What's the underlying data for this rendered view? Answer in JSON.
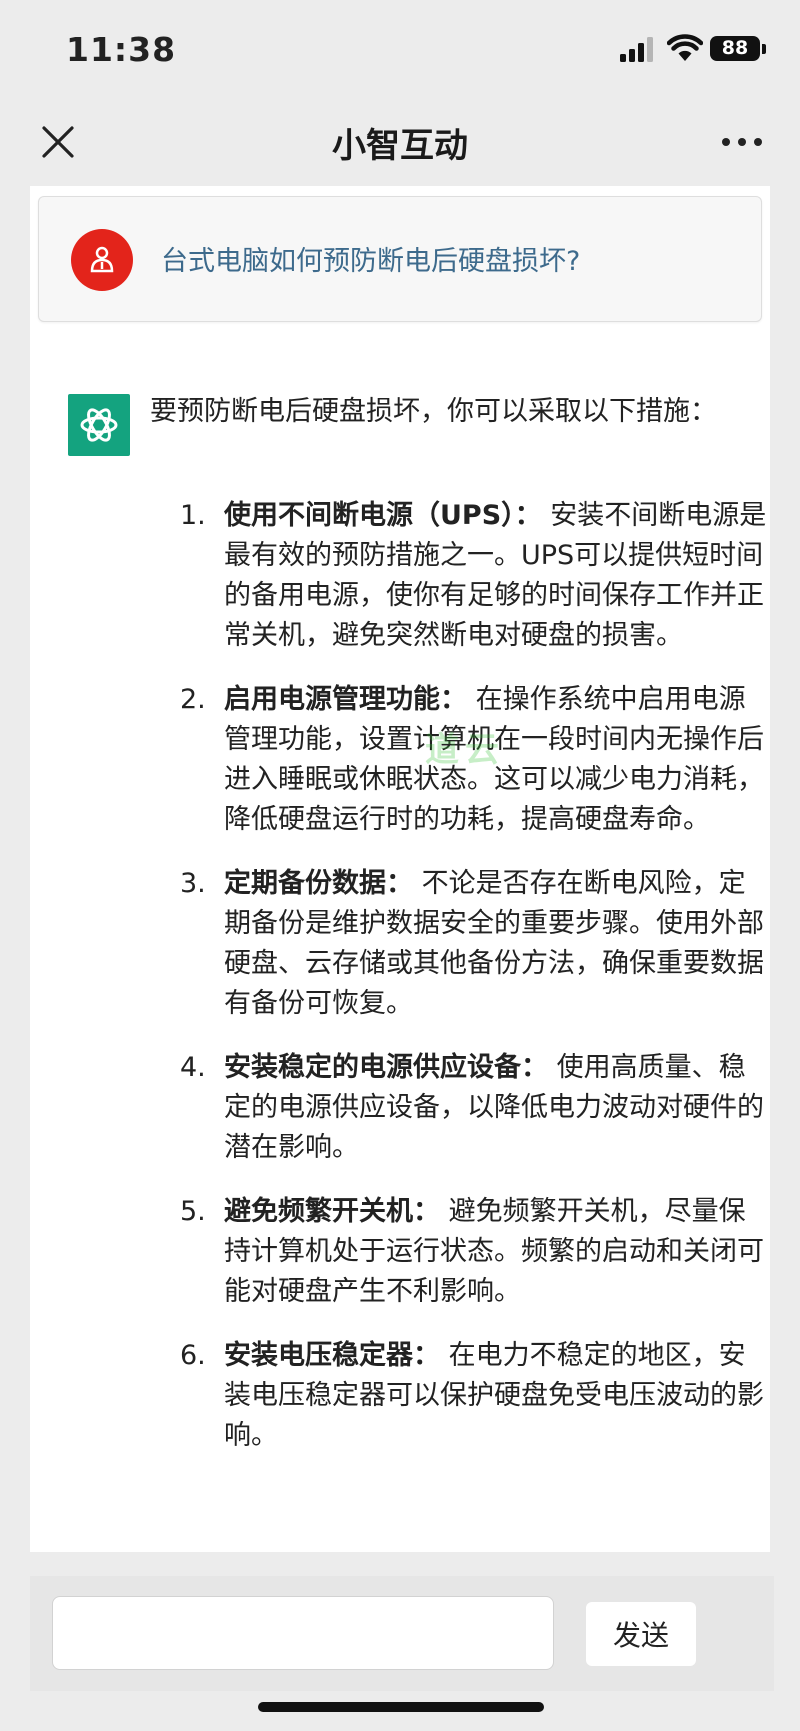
{
  "status_bar": {
    "time": "11:38",
    "battery": "88"
  },
  "nav": {
    "title": "小智互动",
    "close_icon": "close-icon",
    "more_icon": "more-dots-icon"
  },
  "question": {
    "text": "台式电脑如何预防断电后硬盘损坏?",
    "avatar_icon": "user-avatar-icon"
  },
  "answer": {
    "avatar_icon": "chatgpt-logo-icon",
    "intro": "要预防断电后硬盘损坏，你可以采取以下措施：",
    "items": [
      {
        "num": "1.",
        "title": "使用不间断电源（UPS）：",
        "body": " 安装不间断电源是最有效的预防措施之一。UPS可以提供短时间的备用电源，使你有足够的时间保存工作并正常关机，避免突然断电对硬盘的损害。"
      },
      {
        "num": "2.",
        "title": "启用电源管理功能：",
        "body": " 在操作系统中启用电源管理功能，设置计算机在一段时间内无操作后进入睡眠或休眠状态。这可以减少电力消耗，降低硬盘运行时的功耗，提高硬盘寿命。"
      },
      {
        "num": "3.",
        "title": "定期备份数据：",
        "body": " 不论是否存在断电风险，定期备份是维护数据安全的重要步骤。使用外部硬盘、云存储或其他备份方法，确保重要数据有备份可恢复。"
      },
      {
        "num": "4.",
        "title": "安装稳定的电源供应设备：",
        "body": " 使用高质量、稳定的电源供应设备，以降低电力波动对硬件的潜在影响。"
      },
      {
        "num": "5.",
        "title": "避免频繁开关机：",
        "body": " 避免频繁开关机，尽量保持计算机处于运行状态。频繁的启动和关闭可能对硬盘产生不利影响。"
      },
      {
        "num": "6.",
        "title": "安装电压稳定器：",
        "body": " 在电力不稳定的地区，安装电压稳定器可以保护硬盘免受电压波动的影响。"
      }
    ]
  },
  "watermark": "道云",
  "input": {
    "value": "",
    "placeholder": ""
  },
  "send_label": "发送",
  "colors": {
    "question_text": "#3d6a8c",
    "avatar_red": "#e3241b",
    "bot_green": "#14a37f"
  }
}
